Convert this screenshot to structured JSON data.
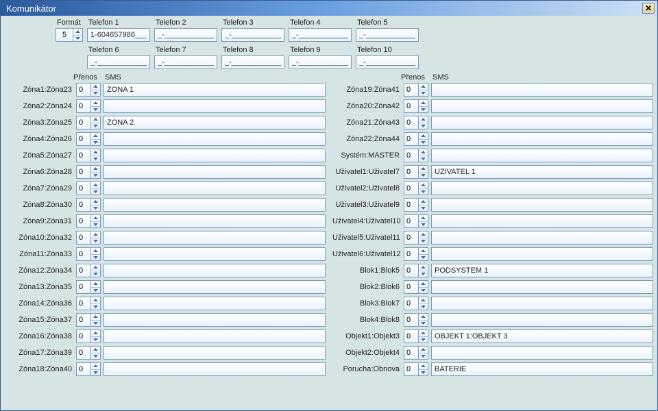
{
  "window": {
    "title": "Komunikátor"
  },
  "format": {
    "label": "Formát",
    "value": "5"
  },
  "tel_labels": [
    "Telefon 1",
    "Telefon 2",
    "Telefon 3",
    "Telefon 4",
    "Telefon 5",
    "Telefon 6",
    "Telefon 7",
    "Telefon 8",
    "Telefon 9",
    "Telefon 10"
  ],
  "tel_values": [
    "1-604657986___",
    "_-____________",
    "_-____________",
    "_-____________",
    "_-____________",
    "_-____________",
    "_-____________",
    "_-____________",
    "_-____________",
    "_-____________"
  ],
  "headers": {
    "prenos": "Přenos",
    "sms": "SMS"
  },
  "left_rows": [
    {
      "label": "Zóna1:Zóna23",
      "prenos": "0",
      "sms": "ZONA 1"
    },
    {
      "label": "Zóna2:Zóna24",
      "prenos": "0",
      "sms": ""
    },
    {
      "label": "Zóna3:Zóna25",
      "prenos": "0",
      "sms": "ZONA 2"
    },
    {
      "label": "Zóna4:Zóna26",
      "prenos": "0",
      "sms": ""
    },
    {
      "label": "Zóna5:Zóna27",
      "prenos": "0",
      "sms": ""
    },
    {
      "label": "Zóna6:Zóna28",
      "prenos": "0",
      "sms": ""
    },
    {
      "label": "Zóna7:Zóna29",
      "prenos": "0",
      "sms": ""
    },
    {
      "label": "Zóna8:Zóna30",
      "prenos": "0",
      "sms": ""
    },
    {
      "label": "Zóna9:Zóna31",
      "prenos": "0",
      "sms": ""
    },
    {
      "label": "Zóna10:Zóna32",
      "prenos": "0",
      "sms": ""
    },
    {
      "label": "Zóna11:Zóna33",
      "prenos": "0",
      "sms": ""
    },
    {
      "label": "Zóna12:Zóna34",
      "prenos": "0",
      "sms": ""
    },
    {
      "label": "Zóna13:Zóna35",
      "prenos": "0",
      "sms": ""
    },
    {
      "label": "Zóna14:Zóna36",
      "prenos": "0",
      "sms": ""
    },
    {
      "label": "Zóna15:Zóna37",
      "prenos": "0",
      "sms": ""
    },
    {
      "label": "Zóna16:Zóna38",
      "prenos": "0",
      "sms": ""
    },
    {
      "label": "Zóna17:Zóna39",
      "prenos": "0",
      "sms": ""
    },
    {
      "label": "Zóna18:Zóna40",
      "prenos": "0",
      "sms": ""
    }
  ],
  "right_rows": [
    {
      "label": "Zóna19:Zóna41",
      "prenos": "0",
      "sms": ""
    },
    {
      "label": "Zóna20:Zóna42",
      "prenos": "0",
      "sms": ""
    },
    {
      "label": "Zóna21:Zóna43",
      "prenos": "0",
      "sms": ""
    },
    {
      "label": "Zóna22:Zóna44",
      "prenos": "0",
      "sms": ""
    },
    {
      "label": "Systém:MASTER",
      "prenos": "0",
      "sms": ""
    },
    {
      "label": "Uživatel1:Uživatel7",
      "prenos": "0",
      "sms": "UZIVATEL 1"
    },
    {
      "label": "Uživatel2:Uživatel8",
      "prenos": "0",
      "sms": ""
    },
    {
      "label": "Uživatel3:Uživatel9",
      "prenos": "0",
      "sms": ""
    },
    {
      "label": "Uživatel4:Uživatel10",
      "prenos": "0",
      "sms": ""
    },
    {
      "label": "Uživatel5:Uživatel11",
      "prenos": "0",
      "sms": ""
    },
    {
      "label": "Uživatel6:Uživatel12",
      "prenos": "0",
      "sms": ""
    },
    {
      "label": "Blok1:Blok5",
      "prenos": "0",
      "sms": "PODSYSTEM 1"
    },
    {
      "label": "Blok2:Blok6",
      "prenos": "0",
      "sms": ""
    },
    {
      "label": "Blok3:Blok7",
      "prenos": "0",
      "sms": ""
    },
    {
      "label": "Blok4:Blok8",
      "prenos": "0",
      "sms": ""
    },
    {
      "label": "Objekt1:Objekt3",
      "prenos": "0",
      "sms": "OBJEKT 1:OBJEKT 3"
    },
    {
      "label": "Objekt2:Objekt4",
      "prenos": "0",
      "sms": ""
    },
    {
      "label": "Porucha:Obnova",
      "prenos": "0",
      "sms": "BATERIE"
    }
  ]
}
